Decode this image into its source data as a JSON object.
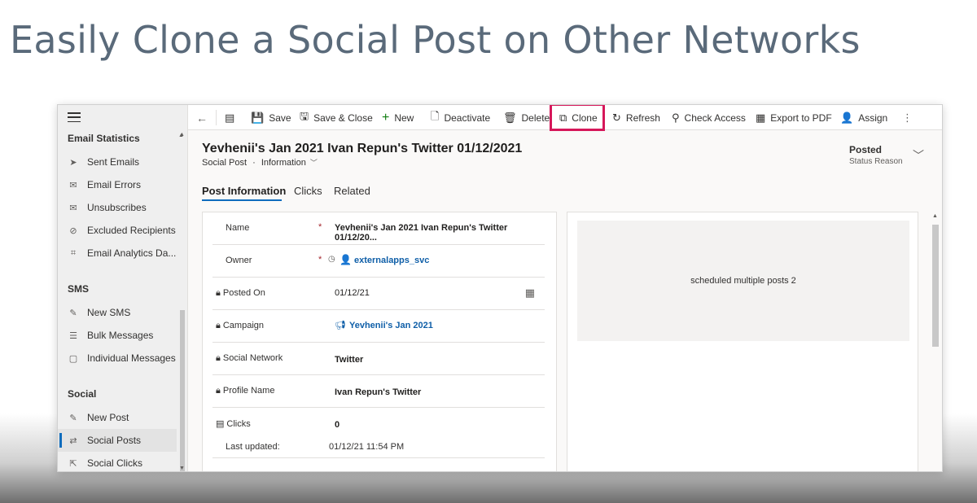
{
  "slide": {
    "title": "Easily Clone a Social Post on Other Networks"
  },
  "sidebar": {
    "sections": [
      {
        "title": "Email Statistics",
        "items": [
          {
            "label": "Sent Emails",
            "icon": "send-icon",
            "glyph": "➤"
          },
          {
            "label": "Email Errors",
            "icon": "email-error-icon",
            "glyph": "✉"
          },
          {
            "label": "Unsubscribes",
            "icon": "unsubscribe-icon",
            "glyph": "✉"
          },
          {
            "label": "Excluded Recipients",
            "icon": "block-icon",
            "glyph": "⊘"
          },
          {
            "label": "Email Analytics Da...",
            "icon": "analytics-icon",
            "glyph": "⌗"
          }
        ]
      },
      {
        "title": "SMS",
        "items": [
          {
            "label": "New SMS",
            "icon": "new-sms-icon",
            "glyph": "✎"
          },
          {
            "label": "Bulk Messages",
            "icon": "bulk-messages-icon",
            "glyph": "☰"
          },
          {
            "label": "Individual Messages",
            "icon": "message-icon",
            "glyph": "▢"
          }
        ]
      },
      {
        "title": "Social",
        "items": [
          {
            "label": "New Post",
            "icon": "new-post-icon",
            "glyph": "✎"
          },
          {
            "label": "Social Posts",
            "icon": "social-posts-icon",
            "glyph": "⇄",
            "active": true
          },
          {
            "label": "Social Clicks",
            "icon": "social-clicks-icon",
            "glyph": "⇱"
          }
        ]
      }
    ]
  },
  "toolbar": {
    "back_glyph": "←",
    "save": "Save",
    "save_close": "Save & Close",
    "new": "New",
    "deactivate": "Deactivate",
    "delete": "Delete",
    "clone": "Clone",
    "refresh": "Refresh",
    "check_access": "Check Access",
    "export_pdf": "Export to PDF",
    "assign": "Assign",
    "more_glyph": "⋮"
  },
  "record": {
    "title": "Yevhenii's Jan 2021 Ivan Repun's Twitter 01/12/2021",
    "entity": "Social Post",
    "separator": "·",
    "form": "Information",
    "status_value": "Posted",
    "status_label": "Status Reason"
  },
  "tabs": [
    "Post Information",
    "Clicks",
    "Related"
  ],
  "fields": {
    "name_label": "Name",
    "name_value": "Yevhenii's Jan 2021 Ivan Repun's Twitter 01/12/20...",
    "owner_label": "Owner",
    "owner_value": "externalapps_svc",
    "posted_on_label": "Posted On",
    "posted_on_value": "01/12/21",
    "campaign_label": "Campaign",
    "campaign_value": "Yevhenii's Jan 2021",
    "network_label": "Social Network",
    "network_value": "Twitter",
    "profile_label": "Profile Name",
    "profile_value": "Ivan Repun's Twitter",
    "clicks_label": "Clicks",
    "clicks_value": "0",
    "last_updated_label": "Last updated:",
    "last_updated_value": "01/12/21 11:54 PM",
    "required_mark": "*"
  },
  "preview": {
    "text": "scheduled multiple posts 2"
  },
  "colors": {
    "accent": "#0f6cbd",
    "highlight": "#d6175a",
    "link": "#0f5fa8"
  }
}
